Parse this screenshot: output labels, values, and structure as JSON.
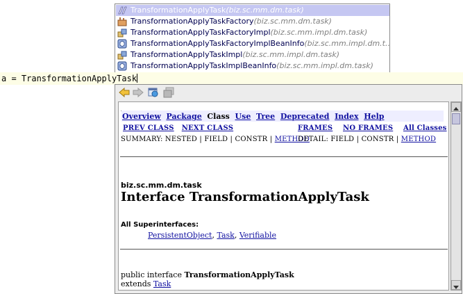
{
  "completion": {
    "items": [
      {
        "name": "TransformationApplyTask",
        "pkg": "(biz.sc.mm.dm.task)",
        "icon": "interface-icon",
        "selected": true
      },
      {
        "name": "TransformationApplyTaskFactory",
        "pkg": "(biz.sc.mm.dm.task)",
        "icon": "factory-icon",
        "selected": false
      },
      {
        "name": "TransformationApplyTaskFactoryImpl",
        "pkg": "(biz.sc.mm.impl.dm.task)",
        "icon": "class-icon",
        "selected": false
      },
      {
        "name": "TransformationApplyTaskFactoryImplBeanInfo",
        "pkg": "(biz.sc.mm.impl.dm.t...",
        "icon": "beaninfo-icon",
        "selected": false
      },
      {
        "name": "TransformationApplyTaskImpl",
        "pkg": "(biz.sc.mm.impl.dm.task)",
        "icon": "class-icon",
        "selected": false
      },
      {
        "name": "TransformationApplyTaskImplBeanInfo",
        "pkg": "(biz.sc.mm.impl.dm.task)",
        "icon": "beaninfo-icon",
        "selected": false
      }
    ]
  },
  "editor": {
    "code": "a = TransformationApplyTask"
  },
  "javadoc": {
    "navbar": {
      "overview": "Overview",
      "package": "Package",
      "class": "Class",
      "use": "Use",
      "tree": "Tree",
      "deprecated": "Deprecated",
      "index": "Index",
      "help": "Help"
    },
    "nav2": {
      "prev_class": "PREV CLASS",
      "next_class": "NEXT CLASS",
      "frames": "FRAMES",
      "no_frames": "NO FRAMES",
      "all_classes": "All Classes"
    },
    "summary": {
      "prefix": "SUMMARY: NESTED | FIELD | CONSTR | ",
      "method": "METHOD",
      "detail_prefix": "DETAIL: FIELD | CONSTR | ",
      "detail_method": "METHOD"
    },
    "package_name": "biz.sc.mm.dm.task",
    "title": "Interface TransformationApplyTask",
    "superinterfaces_label": "All Superinterfaces:",
    "superinterfaces": [
      "PersistentObject",
      "Task",
      "Verifiable"
    ],
    "decl_prefix": "public interface ",
    "decl_name": "TransformationApplyTask",
    "extends_label": "extends ",
    "extends_name": "Task"
  }
}
